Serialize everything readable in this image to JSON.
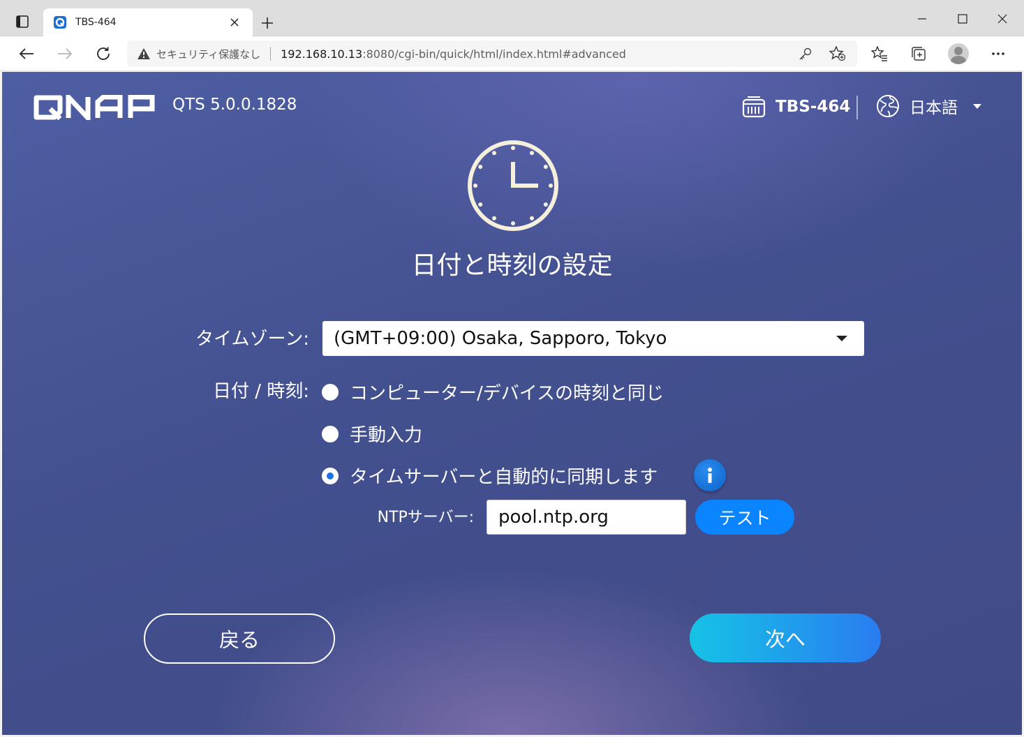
{
  "browser": {
    "tab_title": "TBS-464",
    "security_text": "セキュリティ保護なし",
    "url_host": "192.168.10.13",
    "url_rest": ":8080/cgi-bin/quick/html/index.html#advanced"
  },
  "header": {
    "version": "QTS 5.0.0.1828",
    "device_name": "TBS-464",
    "language": "日本語"
  },
  "main": {
    "title": "日付と時刻の設定",
    "timezone_label": "タイムゾーン:",
    "timezone_value": "(GMT+09:00) Osaka, Sapporo, Tokyo",
    "datetime_label": "日付 / 時刻:",
    "options": [
      {
        "label": "コンピューター/デバイスの時刻と同じ",
        "checked": false
      },
      {
        "label": "手動入力",
        "checked": false
      },
      {
        "label": "タイムサーバーと自動的に同期します",
        "checked": true
      }
    ],
    "ntp_label": "NTPサーバー:",
    "ntp_value": "pool.ntp.org",
    "test_label": "テスト"
  },
  "footer": {
    "back_label": "戻る",
    "next_label": "次へ"
  },
  "colors": {
    "accent": "#0a84ff",
    "next_gradient_start": "#15c3e6",
    "next_gradient_end": "#2a7cf0"
  }
}
